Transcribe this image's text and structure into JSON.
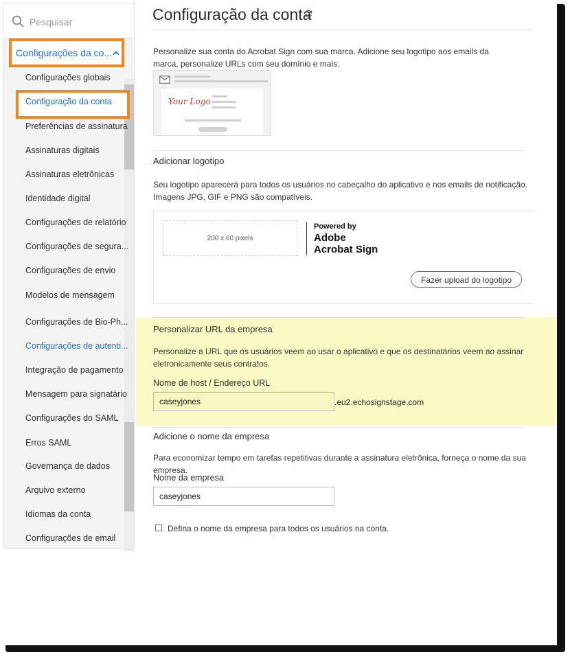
{
  "sidebar": {
    "search_placeholder": "Pesquisar",
    "group_label": "Configurações da co...",
    "items": [
      {
        "label": "Configurações globais"
      },
      {
        "label": "Configuração da conta"
      },
      {
        "label": "Preferências de assinatura"
      },
      {
        "label": "Assinaturas digitais"
      },
      {
        "label": "Assinaturas eletrônicas"
      },
      {
        "label": "Identidade digital"
      },
      {
        "label": "Configurações de relatório"
      },
      {
        "label": "Configurações de segura..."
      },
      {
        "label": "Configurações de envio"
      },
      {
        "label": "Modelos de mensagem"
      },
      {
        "label": "Configurações de Bio-Ph..."
      },
      {
        "label": "Configurações de autenti..."
      },
      {
        "label": "Integração de pagamento"
      },
      {
        "label": "Mensagem para signatário"
      },
      {
        "label": "Configurações do SAML"
      },
      {
        "label": "Erros SAML"
      },
      {
        "label": "Governança de dados"
      },
      {
        "label": "Arquivo externo"
      },
      {
        "label": "Idiomas da conta"
      },
      {
        "label": "Configurações de email"
      }
    ]
  },
  "main": {
    "title": "Configuração da conta",
    "intro_line1": "Personalize sua conta do Acrobat Sign com sua marca. Adicione seu logotipo aos emails da",
    "intro_line2": "marca, personalize URLs com seu domínio e mais.",
    "preview_logo_text": "Your Logo",
    "add_logo": {
      "heading": "Adicionar logotipo",
      "desc_line1": "Seu logotipo aparecerá para todos os usuários no cabeçalho do aplicativo e nos emails de notificação.",
      "desc_line2": "Imagens JPG, GIF e PNG são compatíveis.",
      "placeholder_size": "200 x 60 pixels",
      "powered_by": "Powered by",
      "brand_line1": "Adobe",
      "brand_line2": "Acrobat Sign",
      "upload_button": "Fazer upload do logotipo"
    },
    "custom_url": {
      "heading": "Personalizar URL da empresa",
      "desc_line1": "Personalize a URL que os usuários veem ao usar o aplicativo e que os destinatários veem ao assinar",
      "desc_line2": "eletronicamente seus contratos.",
      "field_label": "Nome de host / Endereço URL",
      "field_value": "caseyjones",
      "domain_suffix": ".eu2.echosignstage.com"
    },
    "company_name": {
      "heading": "Adicione o nome da empresa",
      "desc": "Para economizar tempo em tarefas repetitivas durante a assinatura eletrônica, forneça o nome da sua empresa.",
      "field_label": "Nome da empresa",
      "field_value": "caseyjones",
      "checkbox_label": "Defina o nome da empresa para todos os usuários na conta."
    }
  },
  "colors": {
    "accent_blue": "#1473e6",
    "highlight_orange": "#f0861e",
    "highlight_yellow": "#fbf9c4"
  }
}
